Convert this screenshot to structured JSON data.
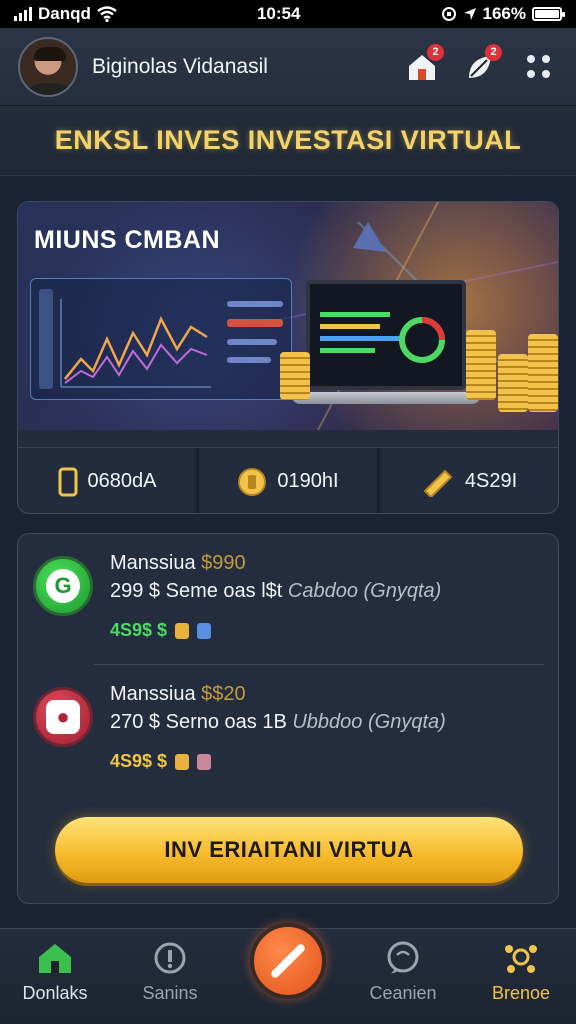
{
  "status_bar": {
    "carrier": "Danqd",
    "time": "10:54",
    "battery": "166%"
  },
  "header": {
    "user_name": "Biginolas Vidanasil",
    "home_badge": "2",
    "alerts_badge": "2"
  },
  "page_title": "ENKSL INVES INVESTASI VIRTUAL",
  "hero": {
    "title": "MIUNS CMBAN",
    "stats": [
      {
        "icon": "phone-icon",
        "value": "0680dA"
      },
      {
        "icon": "coin-icon",
        "value": "0190hI"
      },
      {
        "icon": "gold-bar-icon",
        "value": "4S29I"
      }
    ]
  },
  "transactions": [
    {
      "icon": "g-coin-icon",
      "title": "Manssiua",
      "amount": "$990",
      "description": "299 $ Seme oas l$t",
      "category": "Cabdoo (Gnyqta)",
      "value": "4S9$ $"
    },
    {
      "icon": "bag-icon",
      "title": "Manssiua",
      "amount": "$$20",
      "description": "270 $ Serno oas 1B",
      "category": "Ubbdoo (Gnyqta)",
      "value": "4S9$ $"
    }
  ],
  "cta_label": "INV ERIAITANI VIRTUA",
  "nav": [
    {
      "label": "Donlaks",
      "icon": "home-icon"
    },
    {
      "label": "Sanins",
      "icon": "info-icon"
    },
    {
      "label": "",
      "icon": "pencil-icon"
    },
    {
      "label": "Ceanien",
      "icon": "chat-icon"
    },
    {
      "label": "Brenoe",
      "icon": "network-icon"
    }
  ],
  "colors": {
    "accent_gold": "#f3d36a",
    "positive_green": "#4cd964",
    "cta_orange": "#f5b928",
    "fab_orange": "#e2521b"
  }
}
